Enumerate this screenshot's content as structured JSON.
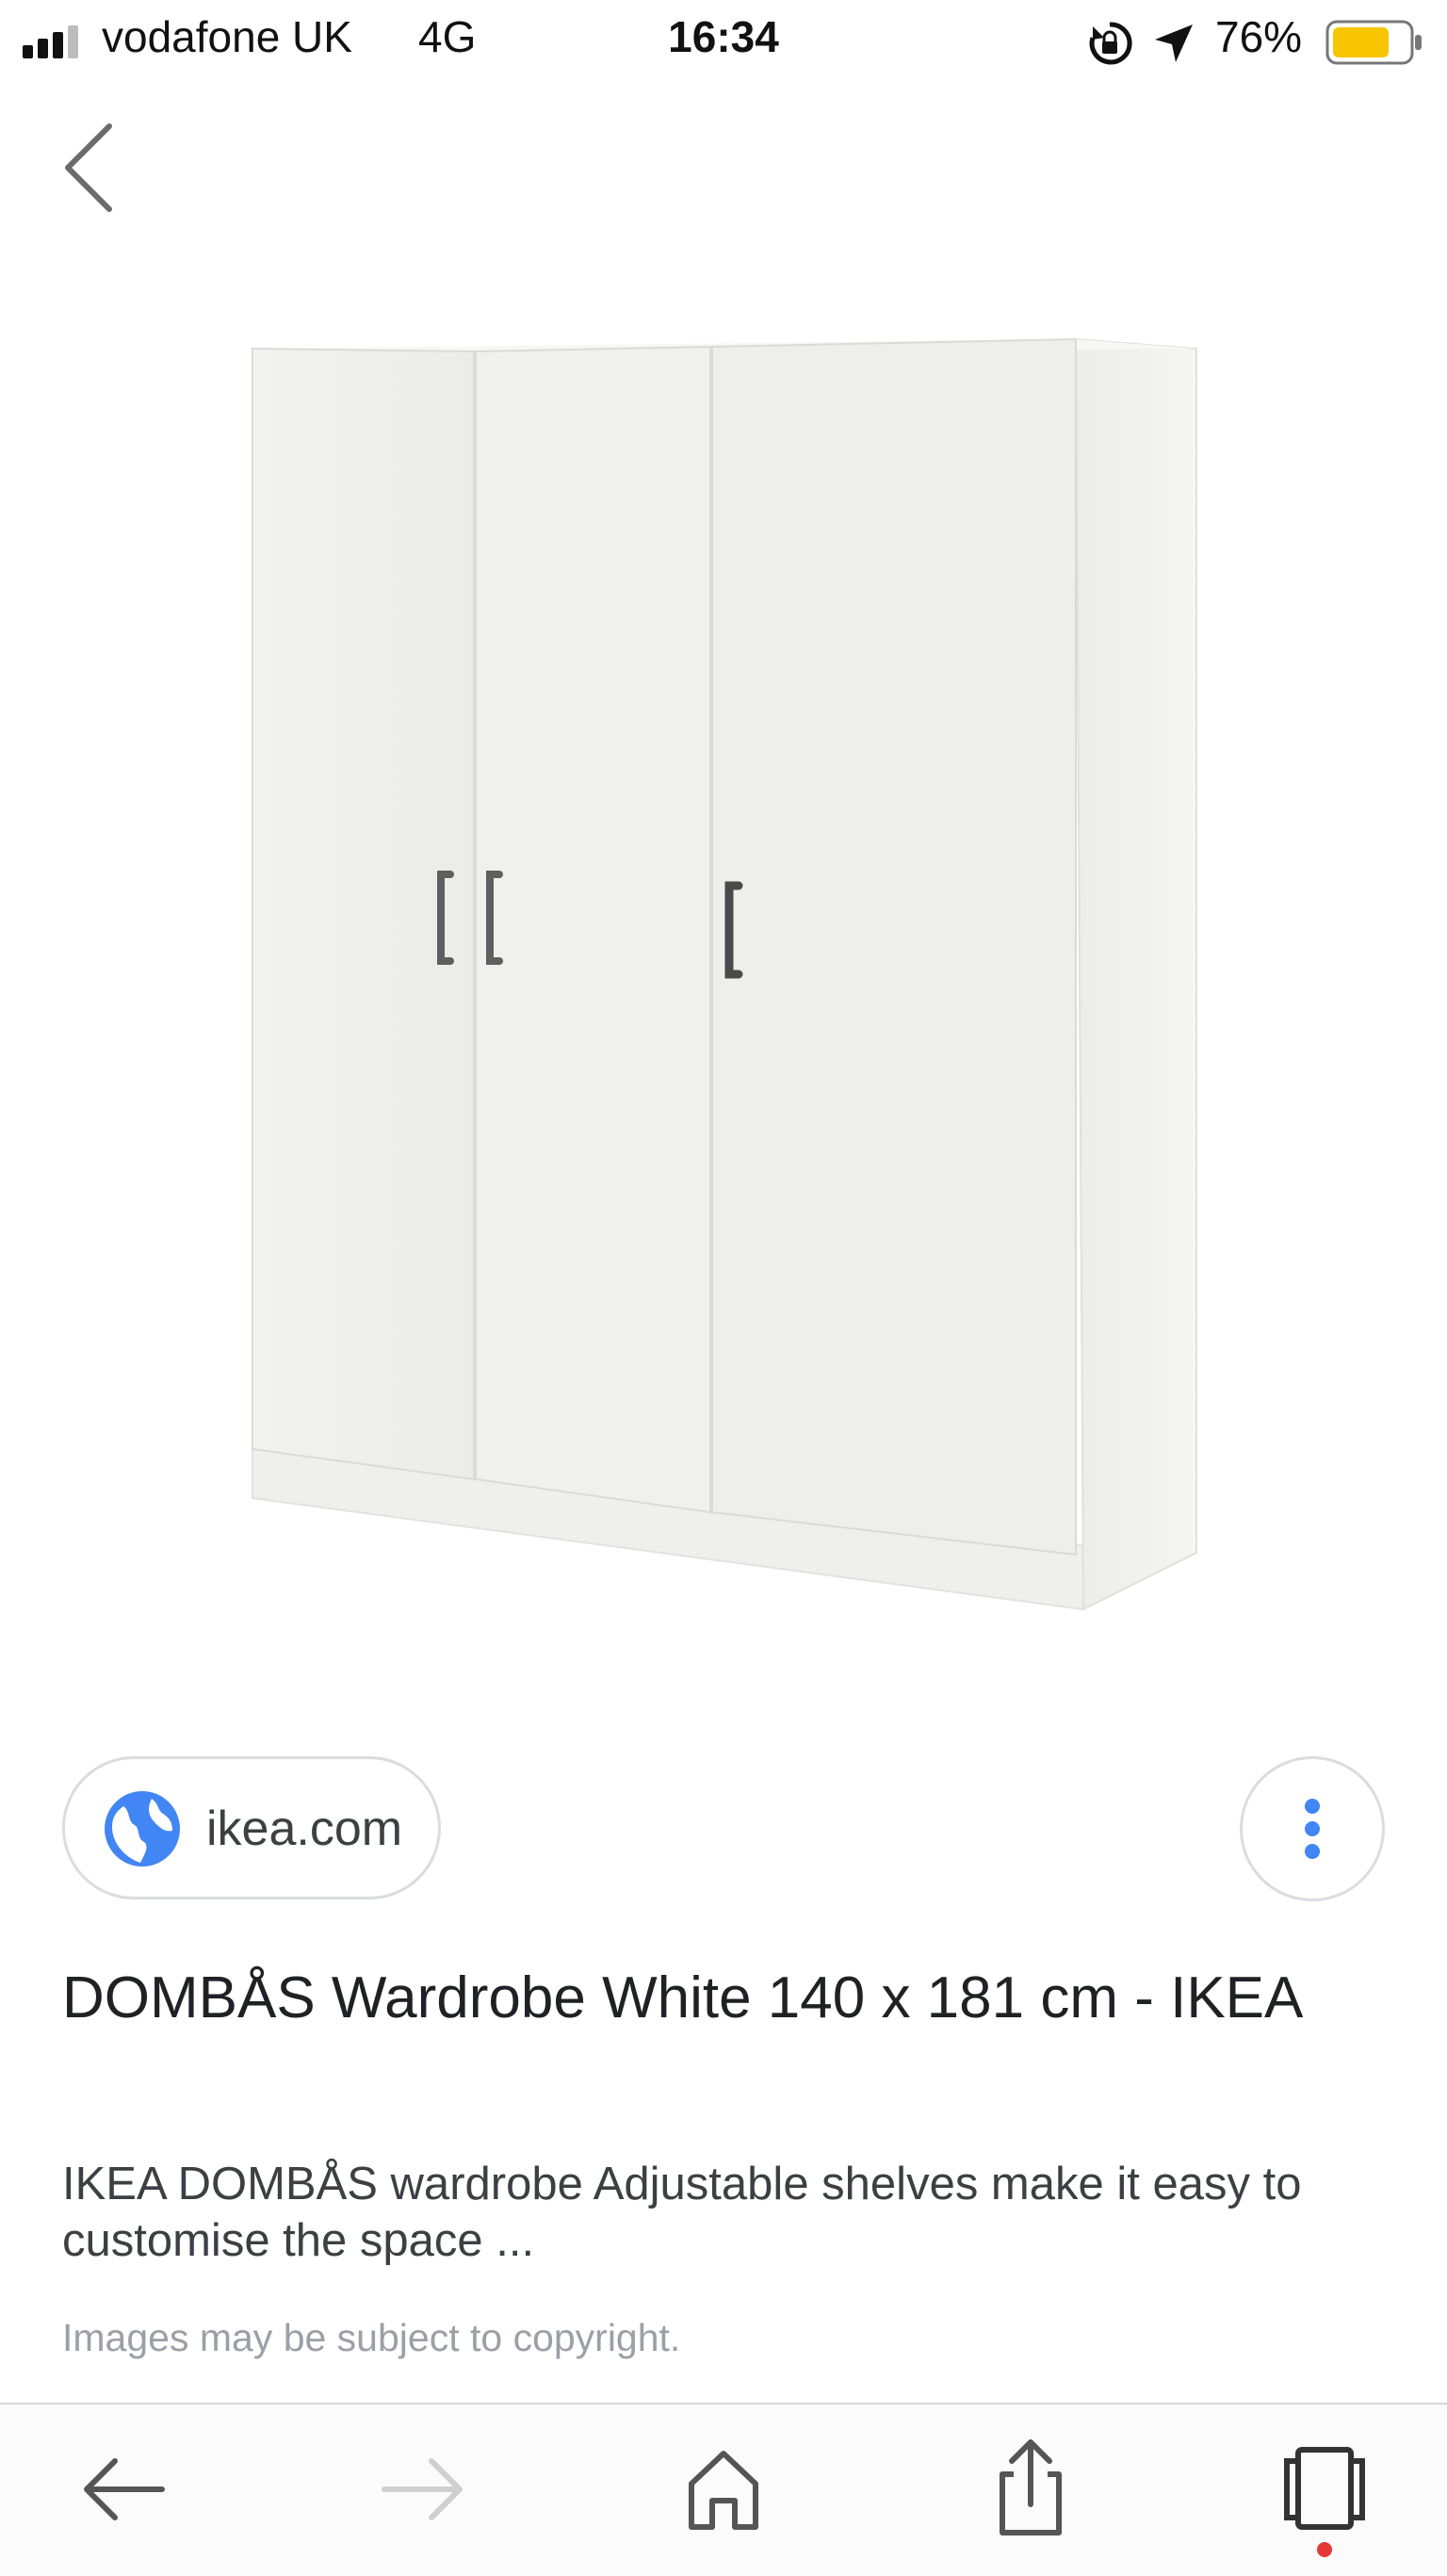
{
  "status_bar": {
    "carrier": "vodafone UK",
    "network": "4G",
    "time": "16:34",
    "battery_percent": "76%",
    "battery_level": 0.76,
    "signal_bars": 3,
    "icons": [
      "signal-icon",
      "orientation-lock-icon",
      "location-arrow-icon",
      "battery-icon"
    ]
  },
  "nav": {
    "back_icon": "chevron-left-icon"
  },
  "result": {
    "source_domain": "ikea.com",
    "source_icon": "globe-icon",
    "more_icon": "more-vert-icon",
    "title": "DOMBÅS Wardrobe White 140 x 181 cm - IKEA",
    "snippet": "IKEA DOMBÅS wardrobe Adjustable shelves make it easy to customise the space ...",
    "copyright_note": "Images may be subject to copyright."
  },
  "toolbar": {
    "items": [
      "back-arrow-icon",
      "forward-arrow-icon",
      "home-icon",
      "share-icon",
      "tabs-icon"
    ]
  },
  "colors": {
    "accent_blue": "#4285f4",
    "battery_fill": "#f7c600",
    "badge_red": "#e53935"
  }
}
